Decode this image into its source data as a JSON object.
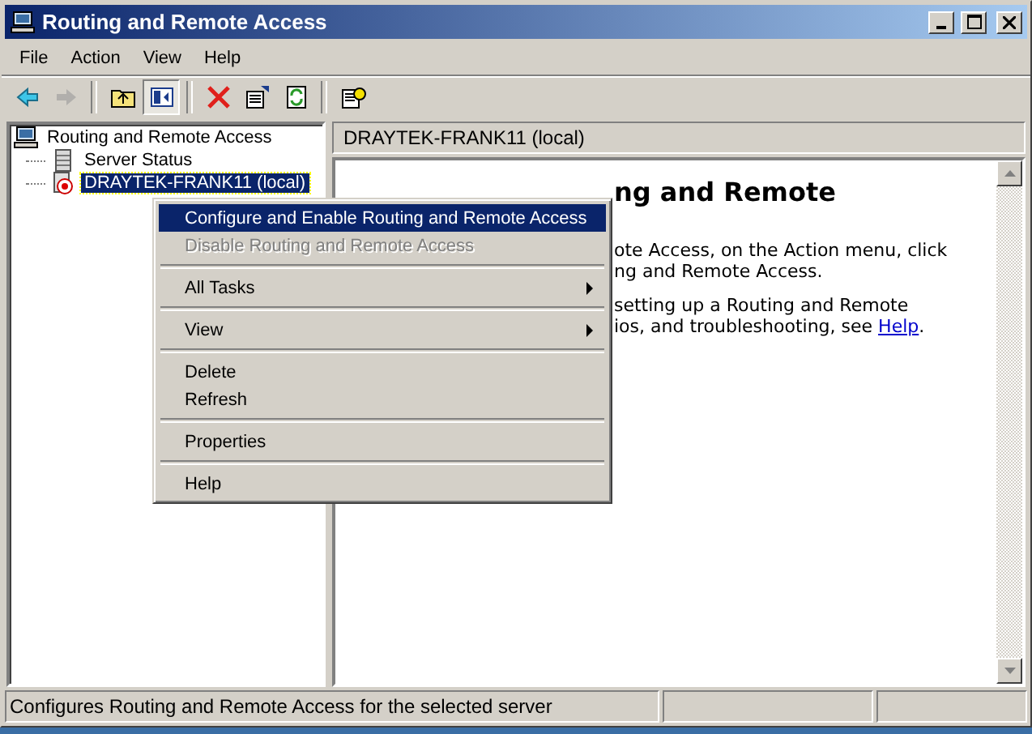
{
  "window": {
    "title": "Routing and Remote Access"
  },
  "menu_bar": [
    "File",
    "Action",
    "View",
    "Help"
  ],
  "toolbar": [
    {
      "kind": "back",
      "disabled": false
    },
    {
      "kind": "forward",
      "disabled": true
    },
    {
      "kind": "separator"
    },
    {
      "kind": "up",
      "disabled": false
    },
    {
      "kind": "tree",
      "disabled": false,
      "pressed": true
    },
    {
      "kind": "separator"
    },
    {
      "kind": "delete",
      "disabled": false
    },
    {
      "kind": "properties",
      "disabled": false
    },
    {
      "kind": "refresh",
      "disabled": false
    },
    {
      "kind": "separator"
    },
    {
      "kind": "help",
      "disabled": false
    }
  ],
  "tree": {
    "label": "Routing and Remote Access",
    "children": [
      {
        "label": "Server Status",
        "kind": "status",
        "selected": false
      },
      {
        "label": "DRAYTEK-FRANK11 (local)",
        "kind": "server",
        "selected": true
      }
    ]
  },
  "details": {
    "header": "DRAYTEK-FRANK11 (local)",
    "heading": "ng and Remote",
    "lines": [
      "ote Access, on the Action menu, click",
      "ng and Remote Access.",
      "setting up a Routing and Remote",
      "ios, and troubleshooting, see "
    ],
    "link": "Help",
    "link_after": "."
  },
  "context_menu": [
    {
      "kind": "item",
      "label": "Configure and Enable Routing and Remote Access",
      "selected": true,
      "disabled": false,
      "submenu": false
    },
    {
      "kind": "item",
      "label": "Disable Routing and Remote Access",
      "selected": false,
      "disabled": true,
      "submenu": false
    },
    {
      "kind": "separator"
    },
    {
      "kind": "item",
      "label": "All Tasks",
      "selected": false,
      "disabled": false,
      "submenu": true
    },
    {
      "kind": "separator"
    },
    {
      "kind": "item",
      "label": "View",
      "selected": false,
      "disabled": false,
      "submenu": true
    },
    {
      "kind": "separator"
    },
    {
      "kind": "item",
      "label": "Delete",
      "selected": false,
      "disabled": false,
      "submenu": false
    },
    {
      "kind": "item",
      "label": "Refresh",
      "selected": false,
      "disabled": false,
      "submenu": false
    },
    {
      "kind": "separator"
    },
    {
      "kind": "item",
      "label": "Properties",
      "selected": false,
      "disabled": false,
      "submenu": false
    },
    {
      "kind": "separator"
    },
    {
      "kind": "item",
      "label": "Help",
      "selected": false,
      "disabled": false,
      "submenu": false
    }
  ],
  "status_bar": {
    "text": "Configures Routing and Remote Access for the selected server"
  }
}
